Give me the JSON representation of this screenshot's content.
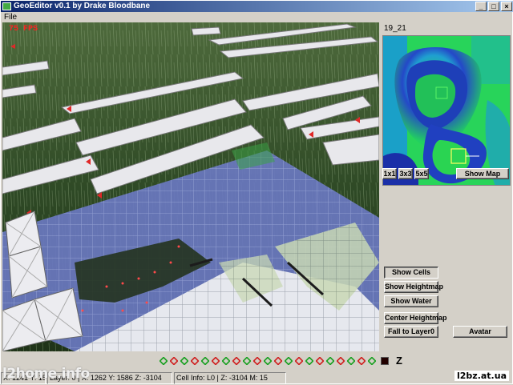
{
  "window": {
    "title": "GeoEditor v0.1 by Drake Bloodbane",
    "min_label": "_",
    "max_label": "□",
    "close_label": "×"
  },
  "menu": {
    "file": "File"
  },
  "viewport": {
    "fps": "75 FPS"
  },
  "side": {
    "map_label": "19_21",
    "zoom_buttons": [
      "1x1",
      "3x3",
      "5x5"
    ],
    "show_map": "Show Map",
    "show_cells": "Show Cells",
    "show_heightmap": "Show Heightmap",
    "show_water": "Show Water",
    "center_heightmap": "Center Heightmap",
    "fall_to_layer": "Fall to Layer0",
    "avatar": "Avatar"
  },
  "bottombar": {
    "diamond_count": 21,
    "diamond_colors": [
      "#18a020",
      "#d02020"
    ],
    "z_label": "Z"
  },
  "status": {
    "coords": "X: 1241 Y: 1574",
    "layer": "Layer: 0 | X: 1262 Y: 1586 Z: -3104",
    "cell_info": "Cell Info: L0 | Z: -3104 M: 15"
  },
  "watermarks": {
    "left": "l2home.info",
    "right": "l2bz.at.ua"
  }
}
